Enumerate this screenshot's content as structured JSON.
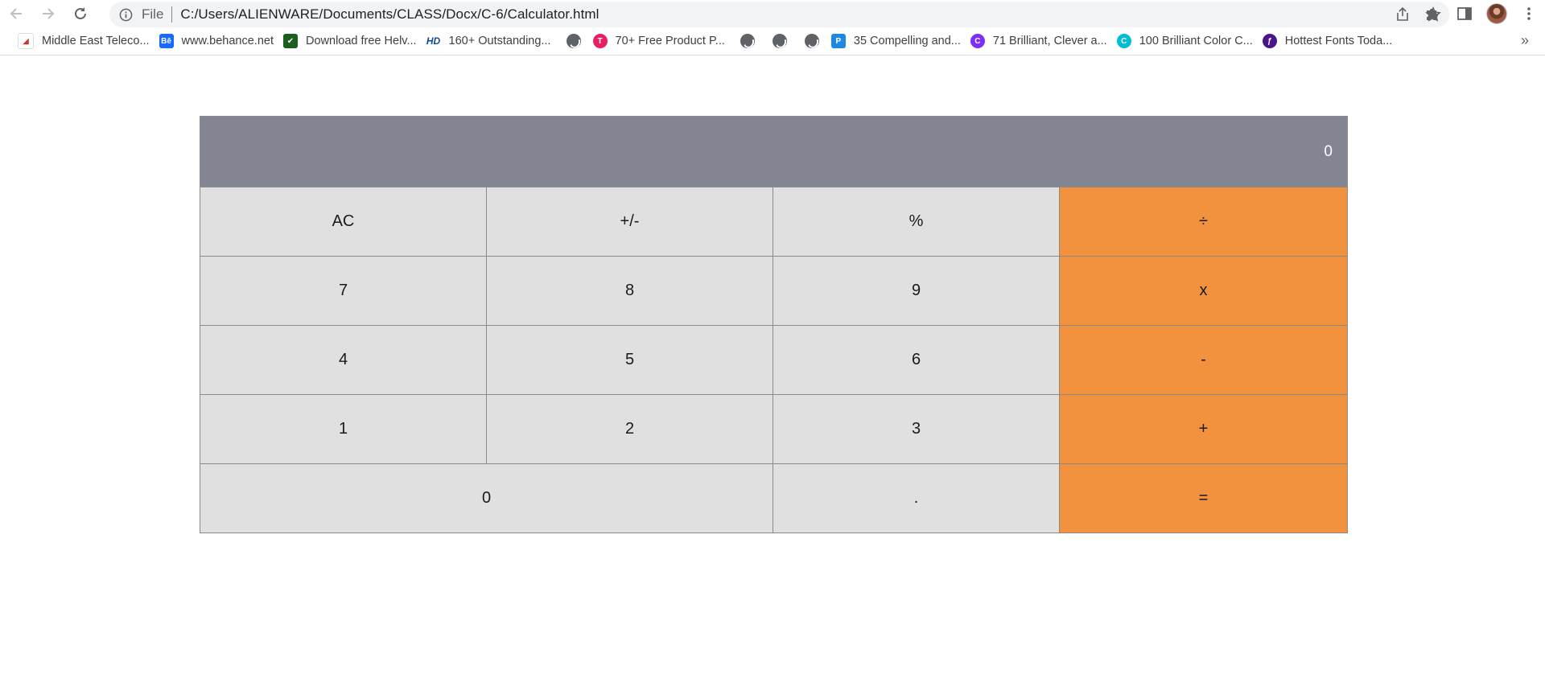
{
  "browser": {
    "address_scheme": "File",
    "url": "C:/Users/ALIENWARE/Documents/CLASS/Docx/C-6/Calculator.html",
    "bookmarks": [
      {
        "label": "Middle East Teleco...",
        "icon": "telecom-icon",
        "color": "#c0392b"
      },
      {
        "label": "www.behance.net",
        "icon": "behance-icon",
        "color": "#1769ff"
      },
      {
        "label": "Download free Helv...",
        "icon": "checkmark-icon",
        "color": "#2e7d32"
      },
      {
        "label": "160+ Outstanding...",
        "icon": "hd-icon",
        "color": "#0d47a1"
      },
      {
        "label": "70+ Free Product P...",
        "icon": "t-icon",
        "color": "#e91e63"
      },
      {
        "label": "35 Compelling and...",
        "icon": "p-icon",
        "color": "#1e88e5"
      },
      {
        "label": "71 Brilliant, Clever a...",
        "icon": "c-icon",
        "color": "#7b2ff7"
      },
      {
        "label": "100 Brilliant Color C...",
        "icon": "c-icon",
        "color": "#00bcd4"
      },
      {
        "label": "Hottest Fonts Toda...",
        "icon": "font-icon",
        "color": "#4a148c"
      }
    ]
  },
  "calculator": {
    "display": "0",
    "keys": [
      {
        "label": "AC",
        "type": "func"
      },
      {
        "label": "+/-",
        "type": "func"
      },
      {
        "label": "%",
        "type": "func"
      },
      {
        "label": "÷",
        "type": "op"
      },
      {
        "label": "7",
        "type": "num"
      },
      {
        "label": "8",
        "type": "num"
      },
      {
        "label": "9",
        "type": "num"
      },
      {
        "label": "x",
        "type": "op"
      },
      {
        "label": "4",
        "type": "num"
      },
      {
        "label": "5",
        "type": "num"
      },
      {
        "label": "6",
        "type": "num"
      },
      {
        "label": "-",
        "type": "op"
      },
      {
        "label": "1",
        "type": "num"
      },
      {
        "label": "2",
        "type": "num"
      },
      {
        "label": "3",
        "type": "num"
      },
      {
        "label": "+",
        "type": "op"
      },
      {
        "label": "0",
        "type": "num"
      },
      {
        "label": ".",
        "type": "num"
      },
      {
        "label": "=",
        "type": "op"
      }
    ],
    "colors": {
      "display_bg": "#838593",
      "key_bg": "#e0e0e0",
      "operator_bg": "#f2923e"
    }
  }
}
